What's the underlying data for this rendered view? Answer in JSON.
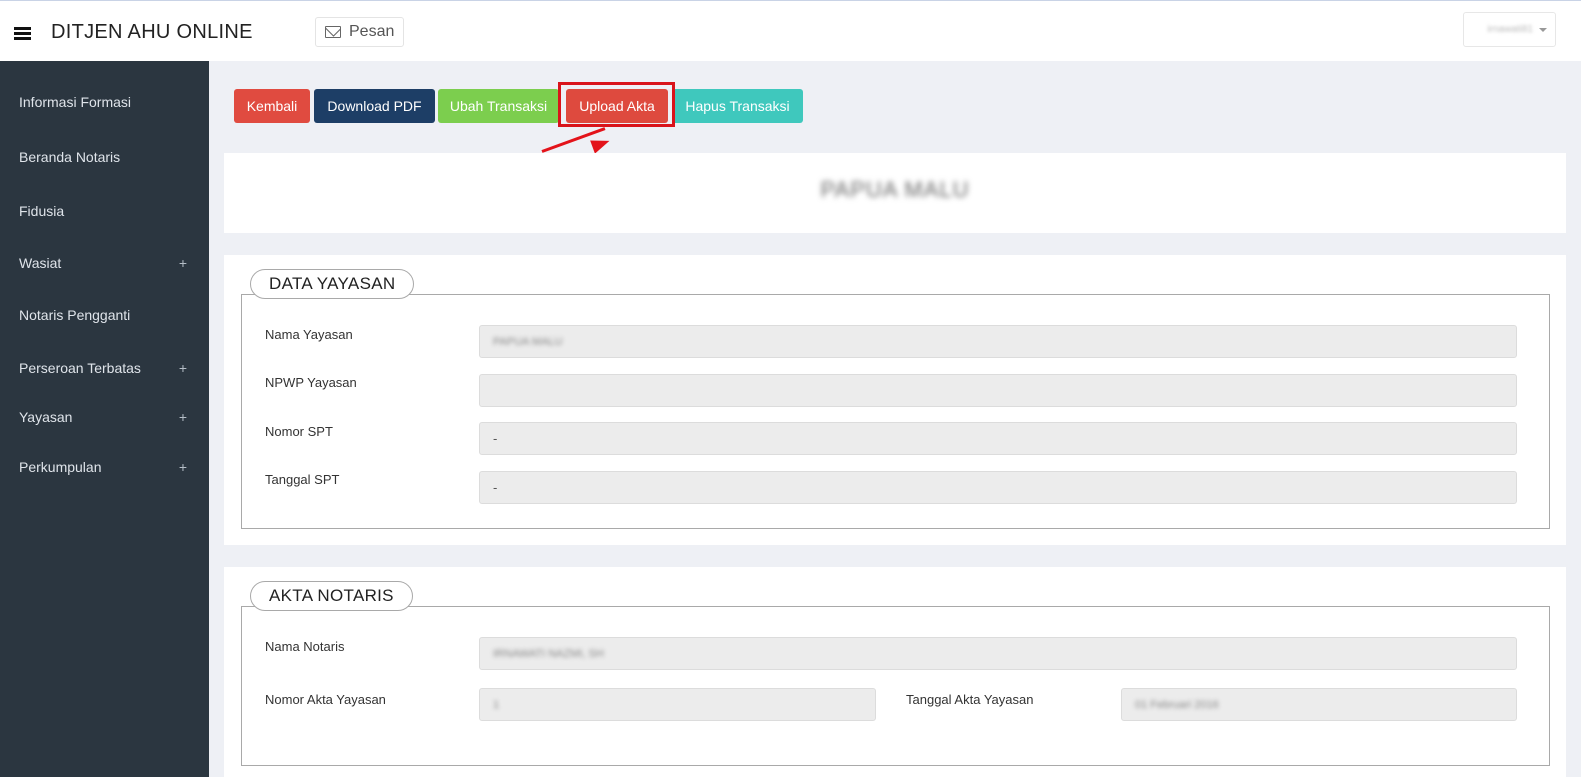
{
  "header": {
    "brand": "DITJEN AHU ONLINE",
    "message_button": "Pesan",
    "user": "irnawati81"
  },
  "sidebar": {
    "items": [
      {
        "label": "Informasi Formasi",
        "expandable": false
      },
      {
        "label": "Beranda Notaris",
        "expandable": false
      },
      {
        "label": "Fidusia",
        "expandable": false
      },
      {
        "label": "Wasiat",
        "expandable": true
      },
      {
        "label": "Notaris Pengganti",
        "expandable": false
      },
      {
        "label": "Perseroan Terbatas",
        "expandable": true
      },
      {
        "label": "Yayasan",
        "expandable": true
      },
      {
        "label": "Perkumpulan",
        "expandable": true
      }
    ],
    "expand_symbol": "+"
  },
  "actions": {
    "kembali": "Kembali",
    "download_pdf": "Download PDF",
    "ubah_transaksi": "Ubah Transaksi",
    "upload_akta": "Upload Akta",
    "hapus_transaksi": "Hapus Transaksi"
  },
  "title": "PAPUA MALU",
  "data_yayasan": {
    "legend": "DATA YAYASAN",
    "fields": [
      {
        "label": "Nama Yayasan",
        "value": "PAPUA MALU"
      },
      {
        "label": "NPWP Yayasan",
        "value": ""
      },
      {
        "label": "Nomor SPT",
        "value": "-"
      },
      {
        "label": "Tanggal SPT",
        "value": "-"
      }
    ]
  },
  "akta_notaris": {
    "legend": "AKTA NOTARIS",
    "nama_notaris": {
      "label": "Nama Notaris",
      "value": "IRNAWATI NAZMI, SH"
    },
    "nomor_akta": {
      "label": "Nomor Akta Yayasan",
      "value": "1"
    },
    "tanggal_akta": {
      "label": "Tanggal Akta Yayasan",
      "value": "01 Februari 2016"
    }
  },
  "colors": {
    "sidebar_bg": "#2b3640",
    "kembali": "#e04b40",
    "download_pdf": "#1d3e66",
    "ubah_transaksi": "#7cce4e",
    "upload_akta": "#de4a3e",
    "hapus_transaksi": "#3fc8bd",
    "highlight": "#d9141b"
  }
}
